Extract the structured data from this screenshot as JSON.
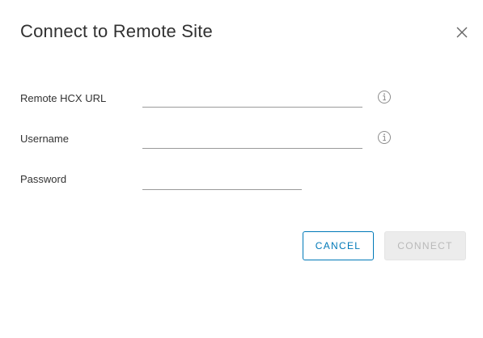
{
  "dialog": {
    "title": "Connect to Remote Site",
    "close_icon": "close-icon"
  },
  "form": {
    "remote_url": {
      "label": "Remote HCX URL",
      "value": "",
      "placeholder": "",
      "info_icon": "info-icon"
    },
    "username": {
      "label": "Username",
      "value": "",
      "placeholder": "",
      "info_icon": "info-icon"
    },
    "password": {
      "label": "Password",
      "value": "",
      "placeholder": ""
    }
  },
  "actions": {
    "cancel_label": "CANCEL",
    "connect_label": "CONNECT",
    "connect_enabled": false
  },
  "colors": {
    "accent": "#0079b8",
    "disabled_bg": "#ececec",
    "disabled_text": "#b9b9b9",
    "field_underline": "#9a9a9a",
    "text": "#333333"
  }
}
